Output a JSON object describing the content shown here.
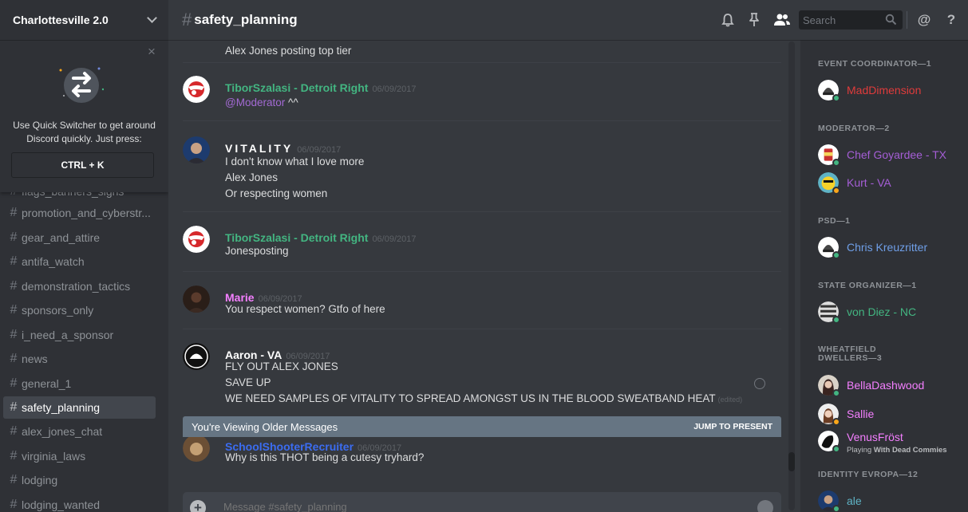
{
  "server": {
    "name": "Charlottesville 2.0"
  },
  "quick_switcher": {
    "text": "Use Quick Switcher to get around Discord quickly. Just press:",
    "shortcut": "CTRL + K",
    "close": "×"
  },
  "channels": [
    {
      "name": "flags_banners_signs",
      "active": false
    },
    {
      "name": "promotion_and_cyberstr...",
      "active": false
    },
    {
      "name": "gear_and_attire",
      "active": false
    },
    {
      "name": "antifa_watch",
      "active": false
    },
    {
      "name": "demonstration_tactics",
      "active": false
    },
    {
      "name": "sponsors_only",
      "active": false
    },
    {
      "name": "i_need_a_sponsor",
      "active": false
    },
    {
      "name": "news",
      "active": false
    },
    {
      "name": "general_1",
      "active": false
    },
    {
      "name": "safety_planning",
      "active": true
    },
    {
      "name": "alex_jones_chat",
      "active": false
    },
    {
      "name": "virginia_laws",
      "active": false
    },
    {
      "name": "lodging",
      "active": false
    },
    {
      "name": "lodging_wanted",
      "active": false
    }
  ],
  "header": {
    "hash": "#",
    "channel": "safety_planning",
    "search_placeholder": "Search",
    "icons": [
      "bell-icon",
      "pin-icon",
      "members-icon",
      "search-icon",
      "mention-icon",
      "help-icon"
    ],
    "mention_glyph": "@",
    "help_glyph": "?"
  },
  "messages": [
    {
      "lines": [
        "Alex Jones posting top tier"
      ]
    },
    {
      "author": "TiborSzalasi - Detroit Right",
      "color": "#43b581",
      "time": "06/09/2017",
      "mention": "@Moderator",
      "lines": [
        "^^"
      ]
    },
    {
      "author": "VITALITY",
      "color": "#ffffff",
      "time": "06/09/2017",
      "lines": [
        "I don't know what I love more",
        "Alex Jones",
        "Or respecting women"
      ]
    },
    {
      "author": "TiborSzalasi - Detroit Right",
      "color": "#43b581",
      "time": "06/09/2017",
      "lines": [
        "Jonesposting"
      ]
    },
    {
      "author": "Marie",
      "color": "#f47fff",
      "time": "06/09/2017",
      "lines": [
        "You respect women? Gtfo of here"
      ]
    },
    {
      "author": "Aaron - VA",
      "color": "#ffffff",
      "time": "06/09/2017",
      "lines": [
        "FLY OUT ALEX JONES",
        "SAVE UP",
        "WE NEED SAMPLES OF VITALITY TO SPREAD AMONGST US IN THE BLOOD SWEATBAND HEAT"
      ],
      "edited": "(edited)"
    },
    {
      "author": "SchoolShooterRecruiter",
      "color": "#3b6cf0",
      "time": "06/09/2017",
      "lines": [
        "Why is this THOT being a cutesy tryhard?"
      ]
    }
  ],
  "older_bar": {
    "text": "You're Viewing Older Messages",
    "jump": "JUMP TO PRESENT"
  },
  "composer": {
    "placeholder": "Message #safety_planning",
    "plus": "+"
  },
  "member_groups": [
    {
      "title": "EVENT COORDINATOR—1",
      "members": [
        {
          "name": "MadDimension",
          "color": "#e03b3b",
          "status": "online"
        }
      ]
    },
    {
      "title": "MODERATOR—2",
      "members": [
        {
          "name": "Chef Goyardee - TX",
          "color": "#a55ed6",
          "status": "online"
        },
        {
          "name": "Kurt - VA",
          "color": "#a55ed6",
          "status": "idle"
        }
      ]
    },
    {
      "title": "PSD—1",
      "members": [
        {
          "name": "Chris Kreuzritter",
          "color": "#6f9fe8",
          "status": "online"
        }
      ]
    },
    {
      "title": "STATE ORGANIZER—1",
      "members": [
        {
          "name": "von Diez - NC",
          "color": "#43b581",
          "status": "online"
        }
      ]
    },
    {
      "title": "WHEATFIELD DWELLERS—3",
      "members": [
        {
          "name": "BellaDashwood",
          "color": "#f47fff",
          "status": "online"
        },
        {
          "name": "Sallie",
          "color": "#f47fff",
          "status": "idle"
        },
        {
          "name": "VenusFröst",
          "color": "#f47fff",
          "status": "online",
          "activity_prefix": "Playing",
          "activity": "With Dead Commies"
        }
      ]
    },
    {
      "title": "IDENTITY EVROPA—12",
      "members": [
        {
          "name": "ale",
          "color": "#5fb3c5",
          "status": "online"
        }
      ]
    }
  ],
  "colors": {
    "online": "#43b581",
    "idle": "#faa61a",
    "active_channel_bg": "#42464d"
  }
}
